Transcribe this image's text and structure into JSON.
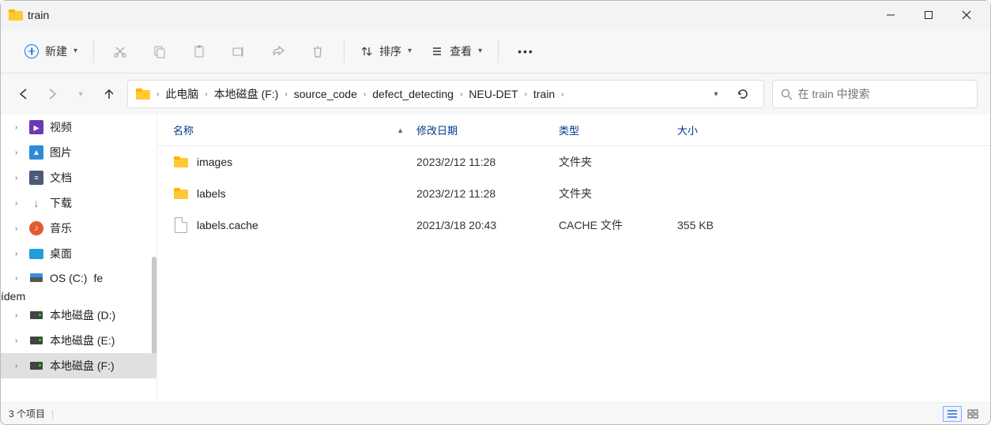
{
  "window": {
    "title": "train"
  },
  "toolbar": {
    "new_label": "新建",
    "sort_label": "排序",
    "view_label": "查看"
  },
  "breadcrumb": {
    "items": [
      "此电脑",
      "本地磁盘 (F:)",
      "source_code",
      "defect_detecting",
      "NEU-DET",
      "train"
    ]
  },
  "search": {
    "placeholder": "在 train 中搜索"
  },
  "sidebar": {
    "items": [
      {
        "label": "视频",
        "icon": "video"
      },
      {
        "label": "图片",
        "icon": "picture"
      },
      {
        "label": "文档",
        "icon": "document"
      },
      {
        "label": "下载",
        "icon": "download"
      },
      {
        "label": "音乐",
        "icon": "music"
      },
      {
        "label": "桌面",
        "icon": "desktop"
      },
      {
        "label": "OS (C:)",
        "icon": "drive-os"
      },
      {
        "label": "本地磁盘 (D:)",
        "icon": "drive"
      },
      {
        "label": "本地磁盘 (E:)",
        "icon": "drive"
      },
      {
        "label": "本地磁盘 (F:)",
        "icon": "drive",
        "selected": true
      }
    ]
  },
  "columns": {
    "name": "名称",
    "date": "修改日期",
    "type": "类型",
    "size": "大小"
  },
  "files": [
    {
      "name": "images",
      "date": "2023/2/12 11:28",
      "type": "文件夹",
      "size": "",
      "kind": "folder"
    },
    {
      "name": "labels",
      "date": "2023/2/12 11:28",
      "type": "文件夹",
      "size": "",
      "kind": "folder"
    },
    {
      "name": "labels.cache",
      "date": "2021/3/18 20:43",
      "type": "CACHE 文件",
      "size": "355 KB",
      "kind": "file"
    }
  ],
  "status": {
    "count_text": "3 个项目"
  }
}
